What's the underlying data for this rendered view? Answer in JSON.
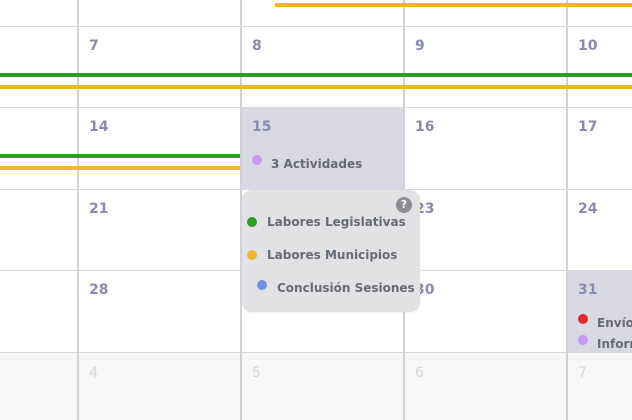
{
  "colors": {
    "green": "#2e9e22",
    "yellow": "#f2b431",
    "purple": "#c79af2",
    "blue": "#6f8fe0",
    "red": "#e02828",
    "selected_bg": "#d9d9e6",
    "daynum": "#8a8ab0"
  },
  "weeks": [
    {
      "days": [
        {
          "day": ""
        },
        {
          "day": ""
        },
        {
          "day": ""
        },
        {
          "day": ""
        },
        {
          "day": ""
        }
      ]
    },
    {
      "days": [
        {
          "day": ""
        },
        {
          "day": "7"
        },
        {
          "day": "8"
        },
        {
          "day": "9"
        },
        {
          "day": "10"
        }
      ]
    },
    {
      "days": [
        {
          "day": ""
        },
        {
          "day": "14"
        },
        {
          "day": "15"
        },
        {
          "day": "16"
        },
        {
          "day": "17"
        }
      ]
    },
    {
      "days": [
        {
          "day": ""
        },
        {
          "day": "21"
        },
        {
          "day": ""
        },
        {
          "day": "23"
        },
        {
          "day": "24"
        }
      ]
    },
    {
      "days": [
        {
          "day": ""
        },
        {
          "day": "28"
        },
        {
          "day": ""
        },
        {
          "day": "30"
        },
        {
          "day": "31"
        }
      ]
    },
    {
      "days": [
        {
          "day": ""
        },
        {
          "day": "4"
        },
        {
          "day": "5"
        },
        {
          "day": "6"
        },
        {
          "day": "7"
        }
      ]
    }
  ],
  "day15": {
    "summary": "3 Actividades"
  },
  "popup": {
    "help_icon": "help-icon",
    "help_glyph": "?",
    "items": [
      {
        "label": "Labores Legislativas",
        "color": "green"
      },
      {
        "label": "Labores Municipios",
        "color": "yellow"
      },
      {
        "label": "Conclusión Sesiones",
        "color": "blue"
      }
    ]
  },
  "day31": {
    "events": [
      {
        "label": "Envío",
        "color": "red"
      },
      {
        "label": "Inforr",
        "color": "purple"
      }
    ]
  }
}
